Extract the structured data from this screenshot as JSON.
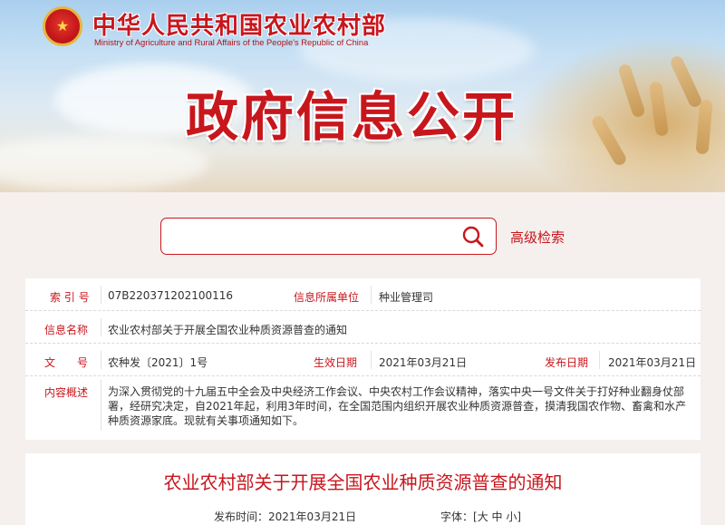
{
  "header": {
    "ministry_cn": "中华人民共和国农业农村部",
    "ministry_en": "Ministry of Agriculture and Rural Affairs of the People's Republic of China",
    "banner_title": "政府信息公开"
  },
  "search": {
    "value": "",
    "placeholder": "",
    "advanced_label": "高级检索"
  },
  "info": {
    "index_label": "索 引 号",
    "index_value": "07B220371202100116",
    "org_label": "信息所属单位",
    "org_value": "种业管理司",
    "name_label": "信息名称",
    "name_value": "农业农村部关于开展全国农业种质资源普查的通知",
    "doc_label": "文　　号",
    "doc_value": "农种发〔2021〕1号",
    "effective_label": "生效日期",
    "effective_value": "2021年03月21日",
    "publish_label": "发布日期",
    "publish_value": "2021年03月21日",
    "summary_label": "内容概述",
    "summary_value": "为深入贯彻党的十九届五中全会及中央经济工作会议、中央农村工作会议精神，落实中央一号文件关于打好种业翻身仗部署，经研究决定，自2021年起，利用3年时间，在全国范围内组织开展农业种质资源普查，摸清我国农作物、畜禽和水产种质资源家底。现就有关事项通知如下。"
  },
  "article": {
    "title": "农业农村部关于开展全国农业种质资源普查的通知",
    "publish_time_label": "发布时间：",
    "publish_time": "2021年03月21日",
    "font_label": "字体：",
    "font_open": "[",
    "font_large": "大",
    "font_medium": "中",
    "font_small": "小",
    "font_close": "]"
  },
  "colors": {
    "brand_red": "#c8161d",
    "page_bg": "#f5f0ed"
  },
  "icons": {
    "emblem": "national-emblem-icon",
    "search": "search-icon"
  }
}
